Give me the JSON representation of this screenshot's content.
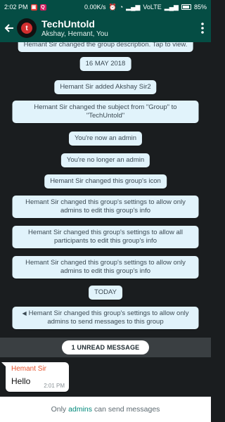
{
  "status_bar": {
    "time": "2:02 PM",
    "speed": "0.00K/s",
    "network": "VoLTE",
    "battery": "85%"
  },
  "header": {
    "title": "TechUntold",
    "subtitle": "Akshay, Hemant, You"
  },
  "messages": {
    "partial_top": "Hemant Sir changed the group description. Tap to view.",
    "date_1": "16 MAY 2018",
    "added": "Hemant Sir added Akshay Sir2",
    "subject_changed": "Hemant Sir changed the subject from \"Group\" to \"TechUntold\"",
    "now_admin": "You're now an admin",
    "no_longer_admin": "You're no longer an admin",
    "icon_changed": "Hemant Sir changed this group's icon",
    "settings_1": "Hemant Sir changed this group's settings to allow only admins to edit this group's info",
    "settings_2": "Hemant Sir changed this group's settings to allow all participants to edit this group's info",
    "settings_3": "Hemant Sir changed this group's settings to allow only admins to edit this group's info",
    "date_2": "TODAY",
    "settings_4": "Hemant Sir changed this group's settings to allow only admins to send messages to this group"
  },
  "unread": {
    "label": "1 UNREAD MESSAGE"
  },
  "chat_message": {
    "sender": "Hemant Sir",
    "text": "Hello",
    "time": "2:01 PM"
  },
  "footer": {
    "prefix": "Only",
    "link": "admins",
    "suffix": "can send messages"
  },
  "colors": {
    "app_bar": "#054d44",
    "chat_background": "#1a1d1f",
    "system_bubble": "#e1f3fb",
    "sender_name": "#e8532d",
    "link": "#00897b"
  },
  "icons": {
    "back": "arrow-left",
    "menu": "more-vertical",
    "lock": "megaphone",
    "avatar": "techuntold-logo"
  }
}
